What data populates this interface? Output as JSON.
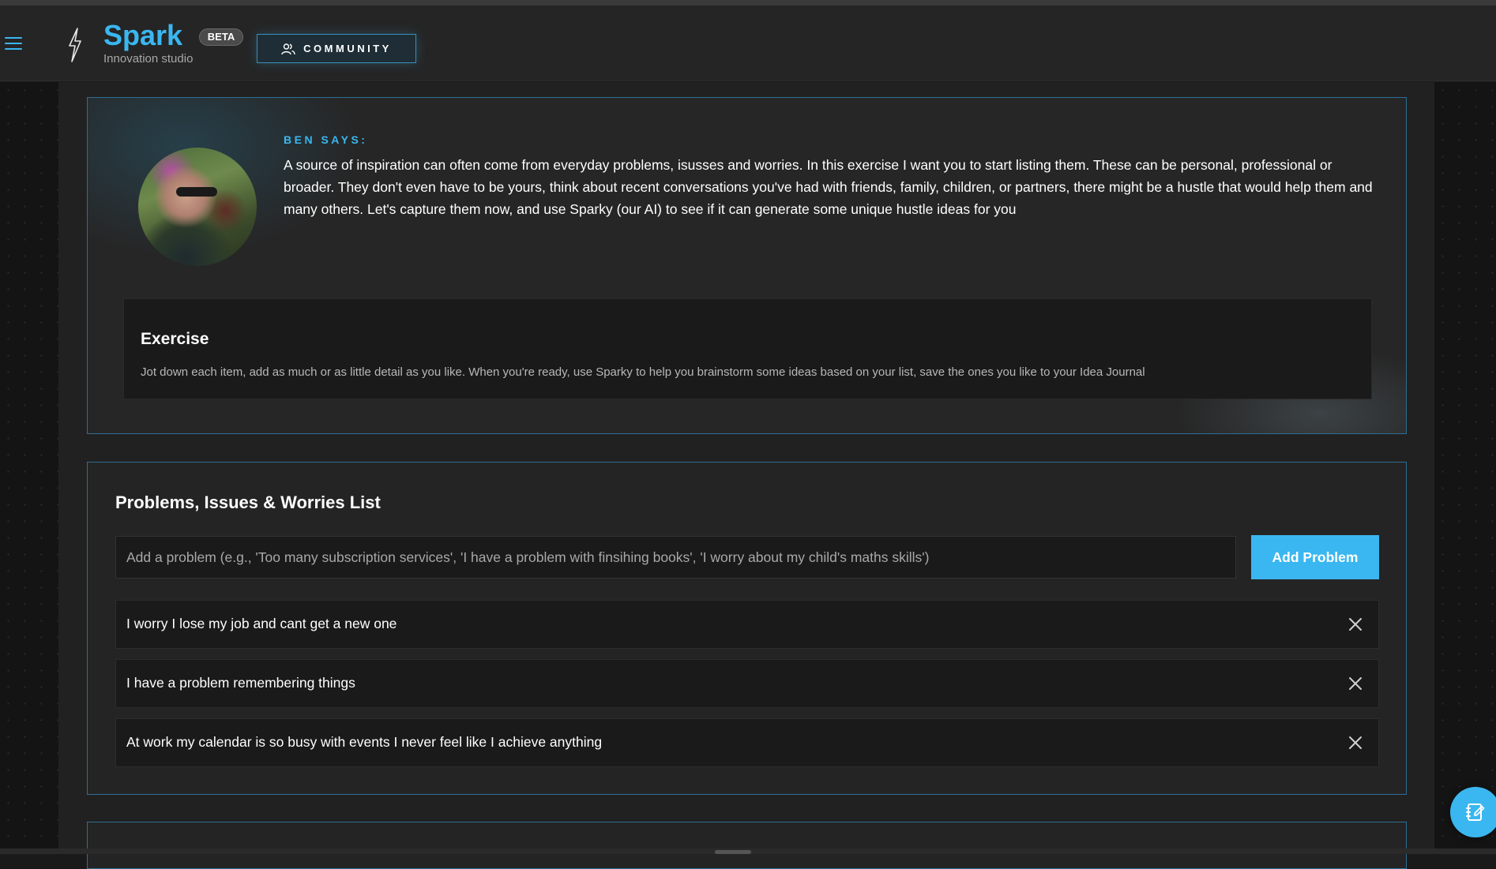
{
  "header": {
    "brand_name": "Spark",
    "brand_subtitle": "Innovation studio",
    "beta_badge": "BETA",
    "community_label": "COMMUNITY"
  },
  "ben": {
    "label": "BEN SAYS:",
    "message": "A source of inspiration can often come from everyday problems, isusses and worries. In this exercise I want you to start listing them. These can be personal, professional or broader. They don't even have to be yours, think about recent conversations you've had with friends, family, children, or partners, there might be a hustle that would help them and many others. Let's capture them now, and use Sparky (our AI) to see if it can generate some unique hustle ideas for you"
  },
  "exercise": {
    "title": "Exercise",
    "text": "Jot down each item, add as much or as little detail as you like. When you're ready, use Sparky to help you brainstorm some ideas based on your list, save the ones you like to your Idea Journal"
  },
  "problems": {
    "title": "Problems, Issues & Worries List",
    "input_placeholder": "Add a problem (e.g., 'Too many subscription services', 'I have a problem with finsihing books', 'I worry about my child's maths skills')",
    "input_value": "",
    "add_label": "Add Problem",
    "items": [
      {
        "text": "I worry I lose my job and cant get a new one"
      },
      {
        "text": "I have a problem remembering things"
      },
      {
        "text": "At work my calendar is so busy with events I never feel like I achieve anything"
      }
    ]
  },
  "icons": {
    "menu": "hamburger-menu-icon",
    "logo": "lightning-bolt-icon",
    "community": "users-icon",
    "remove": "close-icon",
    "fab": "notebook-edit-icon"
  },
  "colors": {
    "accent": "#3ab7f0",
    "card_border": "#2f6e93",
    "background": "#1a1a1a"
  }
}
